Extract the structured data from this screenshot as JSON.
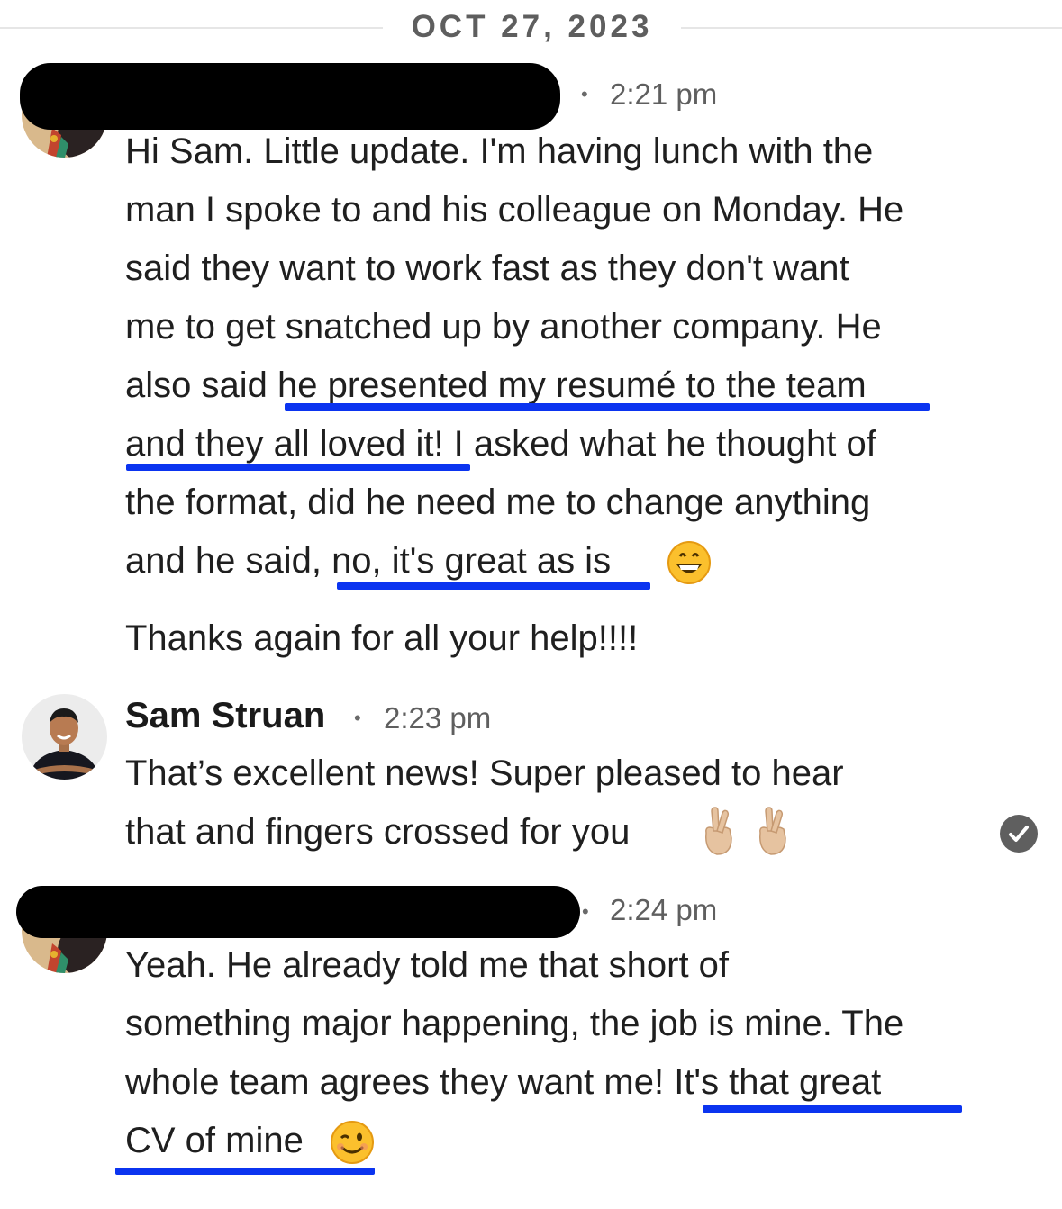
{
  "conversation": {
    "date_divider": "OCT 27, 2023"
  },
  "messages": [
    {
      "sender": "",
      "sender_redacted": true,
      "separator": "•",
      "time": "2:21 pm",
      "lines": [
        "Hi Sam. Little update. I'm having lunch with the",
        "man I spoke to and his colleague on Monday. He",
        "said they want to work fast as they don't want",
        "me to get snatched up by another company. He",
        "also said he presented my resumé to the team",
        "and they all loved it! I asked what he thought of",
        "the format, did he need me to change anything",
        "and he said, no, it's great as is"
      ],
      "emoji_after_last_line": "grinning-face",
      "extra_paragraph": "Thanks again for all your help!!!!"
    },
    {
      "sender": "Sam Struan",
      "separator": "•",
      "time": "2:23 pm",
      "lines": [
        "That’s excellent news! Super pleased to hear",
        "that and fingers crossed for you"
      ],
      "emojis_after_last_line": [
        "crossed-fingers",
        "crossed-fingers"
      ],
      "status_icon": "read-check-icon"
    },
    {
      "sender": "",
      "sender_redacted": true,
      "separator": "•",
      "time": "2:24 pm",
      "lines": [
        "Yeah. He already told me that short of",
        "something major happening, the job is mine. The",
        "whole team agrees they want me! It's that great",
        "CV of mine"
      ],
      "emoji_after_last_line": "winking-face"
    }
  ],
  "annotations": {
    "underline_color": "#0b34f0"
  }
}
